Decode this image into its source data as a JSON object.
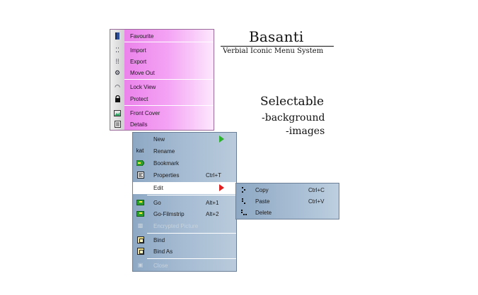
{
  "title": "Basanti",
  "subtitle": "Verbial Iconic Menu System",
  "notes": {
    "line1": "Selectable",
    "line2": "-background",
    "line3": "-images"
  },
  "menu_pink": {
    "background": "#f4a2f4",
    "items": [
      {
        "label": "Favourite",
        "icon": "book-icon",
        "glyph": "▮"
      },
      {
        "label": "Import",
        "icon": "import-dots-icon",
        "glyph": "⁚⁚"
      },
      {
        "label": "Export",
        "icon": "export-dots-icon",
        "glyph": "⁞⁞"
      },
      {
        "label": "Move Out",
        "icon": "gear-icon",
        "glyph": "⚙"
      },
      {
        "label": "Lock View",
        "icon": "eye-icon",
        "glyph": "◠"
      },
      {
        "label": "Protect",
        "icon": "lock-icon",
        "glyph": "🔒"
      },
      {
        "label": "Front Cover",
        "icon": "picture-icon",
        "glyph": "▭"
      },
      {
        "label": "Details",
        "icon": "details-icon",
        "glyph": "▤"
      }
    ]
  },
  "menu_blue": {
    "background": "#a6bcd3",
    "items": [
      {
        "label": "New",
        "icon": "none",
        "glyph": "",
        "shortcut": "",
        "submenu_arrow": "green"
      },
      {
        "label": "Rename",
        "icon": "kat-icon",
        "glyph": "kat",
        "shortcut": ""
      },
      {
        "label": "Bookmark",
        "icon": "bookmark-icon",
        "shortcut": ""
      },
      {
        "label": "Properties",
        "icon": "properties-icon",
        "glyph": "▦",
        "shortcut": "Ctrl+T"
      },
      {
        "label": "Edit",
        "icon": "none",
        "shortcut": "",
        "submenu_arrow": "red",
        "selected": true
      },
      {
        "label": "Go",
        "icon": "go-icon",
        "shortcut": "Alt+1"
      },
      {
        "label": "Go-Filmstrip",
        "icon": "go-filmstrip-icon",
        "shortcut": "Alt+2"
      },
      {
        "label": "Encrypted Picture",
        "icon": "encrypted-picture-icon",
        "glyph": "▩",
        "shortcut": "",
        "disabled": true
      },
      {
        "label": "Bind",
        "icon": "bind-icon",
        "shortcut": ""
      },
      {
        "label": "Bind As",
        "icon": "bind-as-icon",
        "shortcut": ""
      },
      {
        "label": "Close",
        "icon": "close-icon",
        "glyph": "▣",
        "shortcut": "",
        "disabled": true
      }
    ]
  },
  "submenu_edit": {
    "items": [
      {
        "label": "Copy",
        "icon": "copy-icon",
        "glyph": "⁝",
        "shortcut": "Ctrl+C"
      },
      {
        "label": "Paste",
        "icon": "paste-icon",
        "glyph": "⁝",
        "shortcut": "Ctrl+V"
      },
      {
        "label": "Delete",
        "icon": "delete-icon",
        "glyph": "⁝",
        "shortcut": ""
      }
    ]
  }
}
